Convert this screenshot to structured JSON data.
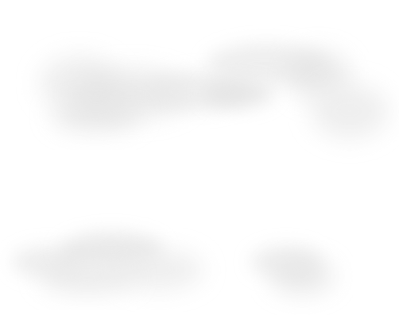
{
  "scene": {
    "background_color": "#ffffff",
    "cloud_color": "#e9e9e9",
    "cloud_shade_color": "#e3e3e3",
    "clouds": [
      {
        "name": "upper-left-cloud"
      },
      {
        "name": "upper-right-cloud"
      },
      {
        "name": "lower-left-cloud"
      },
      {
        "name": "lower-right-cloud"
      }
    ]
  }
}
